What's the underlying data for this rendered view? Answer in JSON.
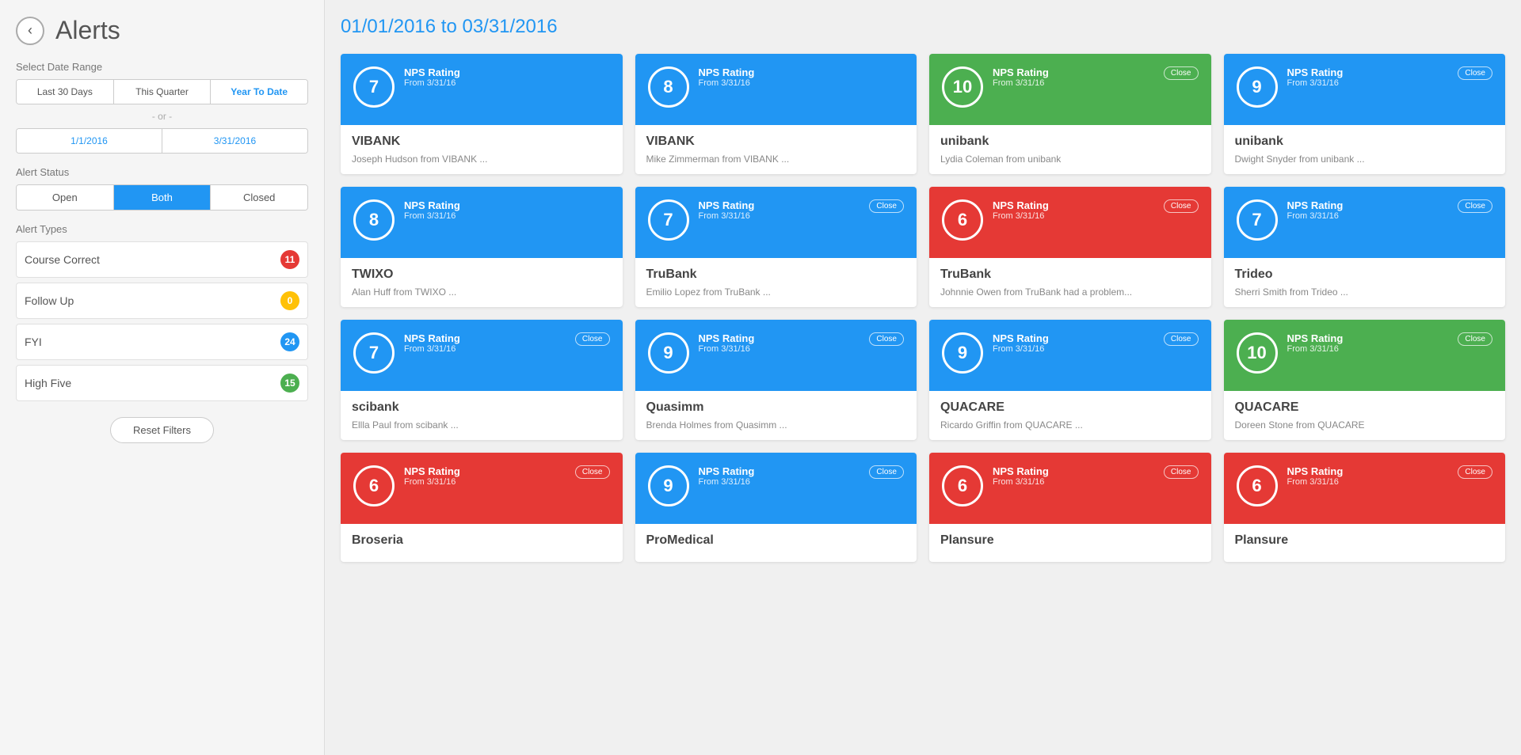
{
  "sidebar": {
    "back_label": "‹",
    "title": "Alerts",
    "date_range_label": "Select Date Range",
    "date_range_buttons": [
      {
        "id": "last30",
        "label": "Last 30 Days",
        "active": false
      },
      {
        "id": "thisquarter",
        "label": "This Quarter",
        "active": false
      },
      {
        "id": "yeartodate",
        "label": "Year To Date",
        "active": true
      }
    ],
    "or_text": "- or -",
    "date_start": "1/1/2016",
    "date_end": "3/31/2016",
    "alert_status_label": "Alert Status",
    "status_buttons": [
      {
        "id": "open",
        "label": "Open",
        "active": false
      },
      {
        "id": "both",
        "label": "Both",
        "active": true
      },
      {
        "id": "closed",
        "label": "Closed",
        "active": false
      }
    ],
    "alert_types_label": "Alert Types",
    "alert_types": [
      {
        "name": "Course Correct",
        "count": "11",
        "badge_color": "badge-red"
      },
      {
        "name": "Follow Up",
        "count": "0",
        "badge_color": "badge-yellow"
      },
      {
        "name": "FYI",
        "count": "24",
        "badge_color": "badge-blue"
      },
      {
        "name": "High Five",
        "count": "15",
        "badge_color": "badge-green"
      }
    ],
    "reset_button_label": "Reset Filters"
  },
  "main": {
    "header_date": "01/01/2016 to 03/31/2016",
    "cards": [
      {
        "nps": "7",
        "color": "blue",
        "rating_text": "NPS Rating",
        "date_text": "From 3/31/16",
        "show_close": false,
        "company": "VIBANK",
        "desc": "Joseph Hudson from VIBANK ..."
      },
      {
        "nps": "8",
        "color": "blue",
        "rating_text": "NPS Rating",
        "date_text": "From 3/31/16",
        "show_close": false,
        "company": "VIBANK",
        "desc": "Mike Zimmerman from VIBANK ..."
      },
      {
        "nps": "10",
        "color": "green",
        "rating_text": "NPS Rating",
        "date_text": "From 3/31/16",
        "show_close": true,
        "close_label": "Close",
        "company": "unibank",
        "desc": "Lydia Coleman from unibank"
      },
      {
        "nps": "9",
        "color": "blue",
        "rating_text": "NPS Rating",
        "date_text": "From 3/31/16",
        "show_close": true,
        "close_label": "Close",
        "company": "unibank",
        "desc": "Dwight Snyder from unibank ..."
      },
      {
        "nps": "8",
        "color": "blue",
        "rating_text": "NPS Rating",
        "date_text": "From 3/31/16",
        "show_close": false,
        "company": "TWIXO",
        "desc": "Alan Huff from TWIXO ..."
      },
      {
        "nps": "7",
        "color": "blue",
        "rating_text": "NPS Rating",
        "date_text": "From 3/31/16",
        "show_close": true,
        "close_label": "Close",
        "company": "TruBank",
        "desc": "Emilio Lopez from TruBank ..."
      },
      {
        "nps": "6",
        "color": "red",
        "rating_text": "NPS Rating",
        "date_text": "From 3/31/16",
        "show_close": true,
        "close_label": "Close",
        "company": "TruBank",
        "desc": "Johnnie Owen from TruBank had a problem..."
      },
      {
        "nps": "7",
        "color": "blue",
        "rating_text": "NPS Rating",
        "date_text": "From 3/31/16",
        "show_close": true,
        "close_label": "Close",
        "company": "Trideo",
        "desc": "Sherri Smith from Trideo ..."
      },
      {
        "nps": "7",
        "color": "blue",
        "rating_text": "NPS Rating",
        "date_text": "From 3/31/16",
        "show_close": true,
        "close_label": "Close",
        "company": "scibank",
        "desc": "Ellla Paul from scibank ..."
      },
      {
        "nps": "9",
        "color": "blue",
        "rating_text": "NPS Rating",
        "date_text": "From 3/31/16",
        "show_close": true,
        "close_label": "Close",
        "company": "Quasimm",
        "desc": "Brenda Holmes from Quasimm ..."
      },
      {
        "nps": "9",
        "color": "blue",
        "rating_text": "NPS Rating",
        "date_text": "From 3/31/16",
        "show_close": true,
        "close_label": "Close",
        "company": "QUACARE",
        "desc": "Ricardo Griffin from QUACARE ..."
      },
      {
        "nps": "10",
        "color": "green",
        "rating_text": "NPS Rating",
        "date_text": "From 3/31/16",
        "show_close": true,
        "close_label": "Close",
        "company": "QUACARE",
        "desc": "Doreen Stone from QUACARE"
      },
      {
        "nps": "6",
        "color": "red",
        "rating_text": "NPS Rating",
        "date_text": "From 3/31/16",
        "show_close": true,
        "close_label": "Close",
        "company": "Broseria",
        "desc": ""
      },
      {
        "nps": "9",
        "color": "blue",
        "rating_text": "NPS Rating",
        "date_text": "From 3/31/16",
        "show_close": true,
        "close_label": "Close",
        "company": "ProMedical",
        "desc": ""
      },
      {
        "nps": "6",
        "color": "red",
        "rating_text": "NPS Rating",
        "date_text": "From 3/31/16",
        "show_close": true,
        "close_label": "Close",
        "company": "Plansure",
        "desc": ""
      },
      {
        "nps": "6",
        "color": "red",
        "rating_text": "NPS Rating",
        "date_text": "From 3/31/16",
        "show_close": true,
        "close_label": "Close",
        "company": "Plansure",
        "desc": ""
      }
    ]
  }
}
